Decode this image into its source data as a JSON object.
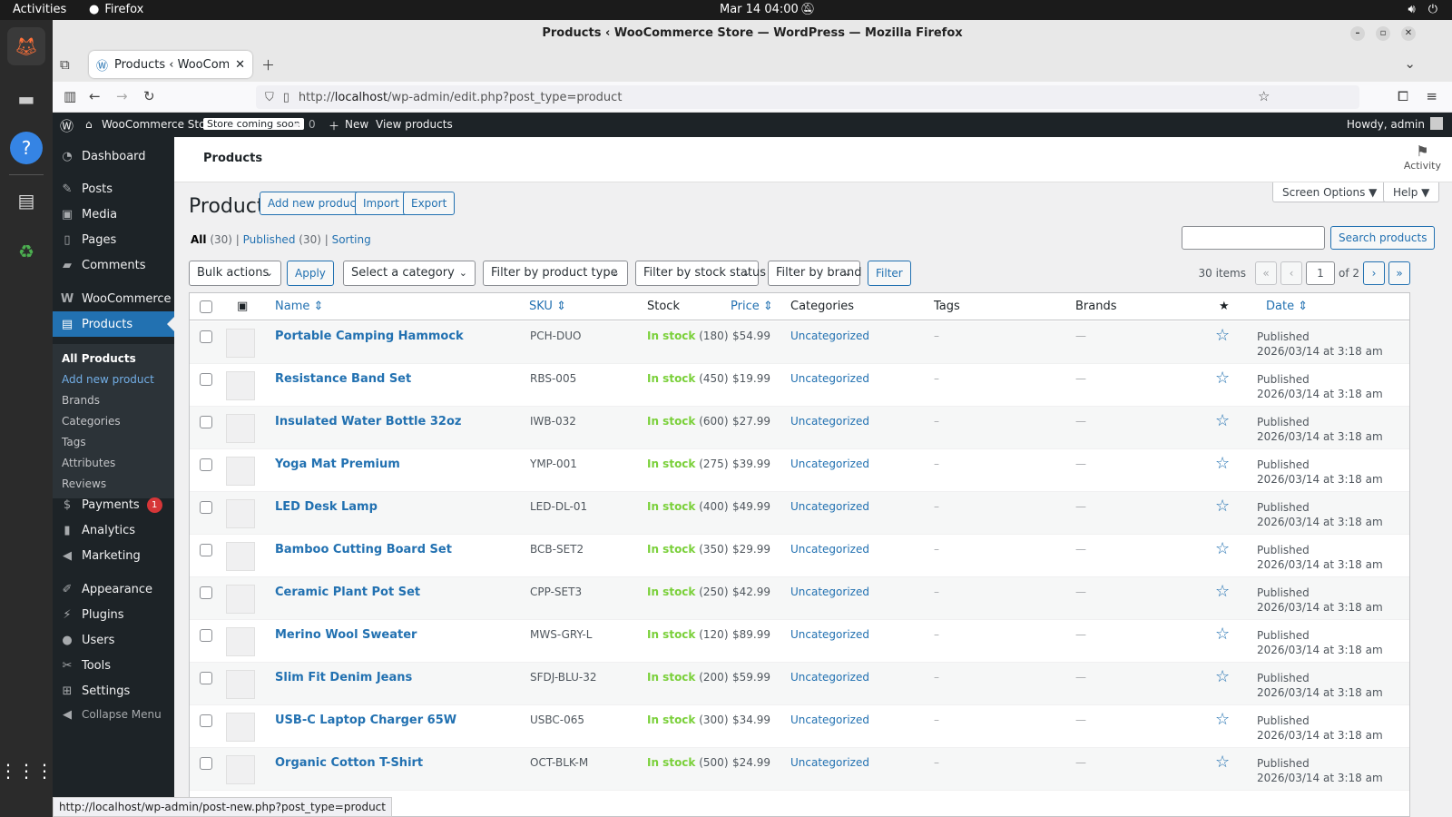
{
  "system": {
    "activities": "Activities",
    "app_name": "Firefox",
    "clock": "Mar 14  04:00"
  },
  "browser": {
    "window_title": "Products ‹ WooCommerce Store — WordPress — Mozilla Firefox",
    "tab_title": "Products ‹ WooCommerce",
    "url_prefix": "http://",
    "url_host": "localhost",
    "url_path": "/wp-admin/edit.php?post_type=product",
    "status_url": "http://localhost/wp-admin/post-new.php?post_type=product"
  },
  "adminbar": {
    "site_name": "WooCommerce Store",
    "coming_soon": "Store coming soon",
    "comments_count": "0",
    "new_label": "New",
    "view_products": "View products",
    "howdy": "Howdy, admin"
  },
  "sidebar": {
    "items": [
      {
        "label": "Dashboard",
        "icon": "dashboard-icon"
      },
      {
        "label": "Posts",
        "icon": "pin-icon"
      },
      {
        "label": "Media",
        "icon": "media-icon"
      },
      {
        "label": "Pages",
        "icon": "page-icon"
      },
      {
        "label": "Comments",
        "icon": "comment-icon"
      },
      {
        "label": "WooCommerce",
        "icon": "woo-icon"
      },
      {
        "label": "Products",
        "icon": "archive-icon"
      },
      {
        "label": "Payments",
        "icon": "dollar-icon"
      },
      {
        "label": "Analytics",
        "icon": "chart-icon"
      },
      {
        "label": "Marketing",
        "icon": "megaphone-icon"
      },
      {
        "label": "Appearance",
        "icon": "brush-icon"
      },
      {
        "label": "Plugins",
        "icon": "plugin-icon"
      },
      {
        "label": "Users",
        "icon": "user-icon"
      },
      {
        "label": "Tools",
        "icon": "wrench-icon"
      },
      {
        "label": "Settings",
        "icon": "settings-icon"
      },
      {
        "label": "Collapse Menu",
        "icon": "collapse-icon"
      }
    ],
    "payments_badge": "1",
    "submenu": [
      "All Products",
      "Add new product",
      "Brands",
      "Categories",
      "Tags",
      "Attributes",
      "Reviews"
    ]
  },
  "header": {
    "title": "Products",
    "activity": "Activity"
  },
  "page": {
    "title": "Products",
    "add_new": "Add new product",
    "import": "Import",
    "export": "Export",
    "screen_options": "Screen Options ▼",
    "help": "Help ▼",
    "views": {
      "all": "All",
      "all_count": "(30)",
      "published": "Published",
      "published_count": "(30)",
      "sorting": "Sorting"
    },
    "search_button": "Search products",
    "bulk_actions": "Bulk actions",
    "apply": "Apply",
    "category_filter": "Select a category",
    "type_filter": "Filter by product type",
    "stock_filter": "Filter by stock status",
    "brand_filter": "Filter by brand",
    "filter_button": "Filter",
    "items_count": "30 items",
    "page_current": "1",
    "page_total": "of 2"
  },
  "table": {
    "headers": {
      "name": "Name",
      "sku": "SKU",
      "stock": "Stock",
      "price": "Price",
      "categories": "Categories",
      "tags": "Tags",
      "brands": "Brands",
      "date": "Date"
    },
    "rows": [
      {
        "name": "Portable Camping Hammock",
        "sku": "PCH-DUO",
        "stock": "In stock",
        "qty": "(180)",
        "price": "$54.99",
        "category": "Uncategorized",
        "tags": "–",
        "brands": "—",
        "status": "Published",
        "date": "2026/03/14 at 3:18 am"
      },
      {
        "name": "Resistance Band Set",
        "sku": "RBS-005",
        "stock": "In stock",
        "qty": "(450)",
        "price": "$19.99",
        "category": "Uncategorized",
        "tags": "–",
        "brands": "—",
        "status": "Published",
        "date": "2026/03/14 at 3:18 am"
      },
      {
        "name": "Insulated Water Bottle 32oz",
        "sku": "IWB-032",
        "stock": "In stock",
        "qty": "(600)",
        "price": "$27.99",
        "category": "Uncategorized",
        "tags": "–",
        "brands": "—",
        "status": "Published",
        "date": "2026/03/14 at 3:18 am"
      },
      {
        "name": "Yoga Mat Premium",
        "sku": "YMP-001",
        "stock": "In stock",
        "qty": "(275)",
        "price": "$39.99",
        "category": "Uncategorized",
        "tags": "–",
        "brands": "—",
        "status": "Published",
        "date": "2026/03/14 at 3:18 am"
      },
      {
        "name": "LED Desk Lamp",
        "sku": "LED-DL-01",
        "stock": "In stock",
        "qty": "(400)",
        "price": "$49.99",
        "category": "Uncategorized",
        "tags": "–",
        "brands": "—",
        "status": "Published",
        "date": "2026/03/14 at 3:18 am"
      },
      {
        "name": "Bamboo Cutting Board Set",
        "sku": "BCB-SET2",
        "stock": "In stock",
        "qty": "(350)",
        "price": "$29.99",
        "category": "Uncategorized",
        "tags": "–",
        "brands": "—",
        "status": "Published",
        "date": "2026/03/14 at 3:18 am"
      },
      {
        "name": "Ceramic Plant Pot Set",
        "sku": "CPP-SET3",
        "stock": "In stock",
        "qty": "(250)",
        "price": "$42.99",
        "category": "Uncategorized",
        "tags": "–",
        "brands": "—",
        "status": "Published",
        "date": "2026/03/14 at 3:18 am"
      },
      {
        "name": "Merino Wool Sweater",
        "sku": "MWS-GRY-L",
        "stock": "In stock",
        "qty": "(120)",
        "price": "$89.99",
        "category": "Uncategorized",
        "tags": "–",
        "brands": "—",
        "status": "Published",
        "date": "2026/03/14 at 3:18 am"
      },
      {
        "name": "Slim Fit Denim Jeans",
        "sku": "SFDJ-BLU-32",
        "stock": "In stock",
        "qty": "(200)",
        "price": "$59.99",
        "category": "Uncategorized",
        "tags": "–",
        "brands": "—",
        "status": "Published",
        "date": "2026/03/14 at 3:18 am"
      },
      {
        "name": "USB-C Laptop Charger 65W",
        "sku": "USBC-065",
        "stock": "In stock",
        "qty": "(300)",
        "price": "$34.99",
        "category": "Uncategorized",
        "tags": "–",
        "brands": "—",
        "status": "Published",
        "date": "2026/03/14 at 3:18 am"
      },
      {
        "name": "Organic Cotton T-Shirt",
        "sku": "OCT-BLK-M",
        "stock": "In stock",
        "qty": "(500)",
        "price": "$24.99",
        "category": "Uncategorized",
        "tags": "–",
        "brands": "—",
        "status": "Published",
        "date": "2026/03/14 at 3:18 am"
      }
    ]
  }
}
